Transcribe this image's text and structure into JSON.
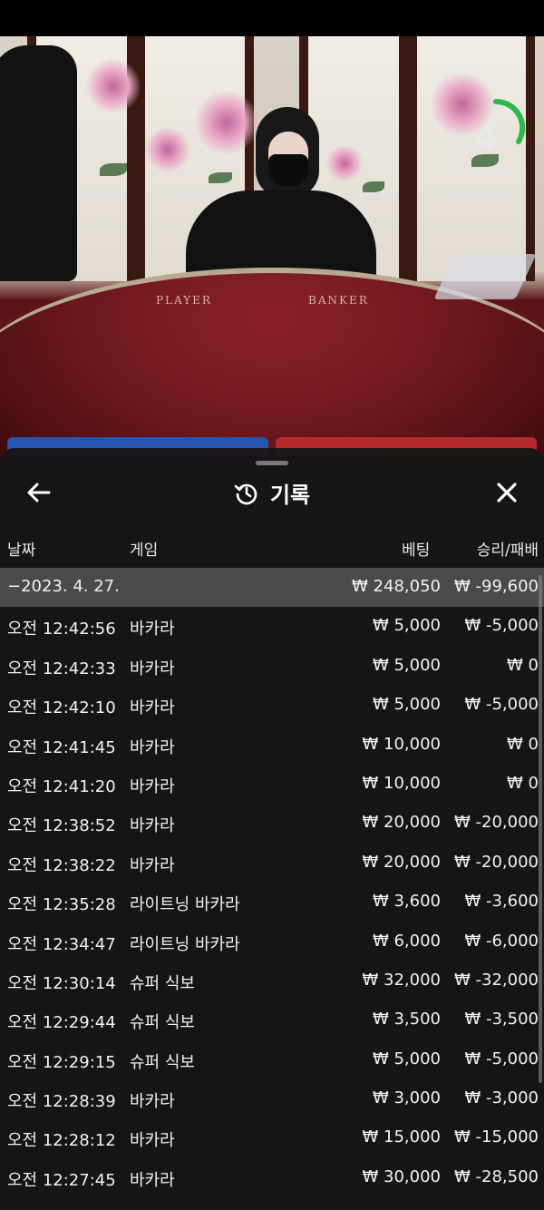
{
  "video": {
    "table_left_label": "PLAYER",
    "table_right_label": "BANKER",
    "timer_value": "4"
  },
  "history": {
    "title": "기록",
    "columns": {
      "date": "날짜",
      "game": "게임",
      "bet": "베팅",
      "result": "승리/패배"
    },
    "date_group": {
      "date": "−2023. 4. 27.",
      "bet": "₩ 248,050",
      "result": "₩ -99,600"
    },
    "rows": [
      {
        "time": "오전 12:42:56",
        "game": "바카라",
        "bet": "₩ 5,000",
        "result": "₩ -5,000"
      },
      {
        "time": "오전 12:42:33",
        "game": "바카라",
        "bet": "₩ 5,000",
        "result": "₩ 0"
      },
      {
        "time": "오전 12:42:10",
        "game": "바카라",
        "bet": "₩ 5,000",
        "result": "₩ -5,000"
      },
      {
        "time": "오전 12:41:45",
        "game": "바카라",
        "bet": "₩ 10,000",
        "result": "₩ 0"
      },
      {
        "time": "오전 12:41:20",
        "game": "바카라",
        "bet": "₩ 10,000",
        "result": "₩ 0"
      },
      {
        "time": "오전 12:38:52",
        "game": "바카라",
        "bet": "₩ 20,000",
        "result": "₩ -20,000"
      },
      {
        "time": "오전 12:38:22",
        "game": "바카라",
        "bet": "₩ 20,000",
        "result": "₩ -20,000"
      },
      {
        "time": "오전 12:35:28",
        "game": "라이트닝 바카라",
        "bet": "₩ 3,600",
        "result": "₩ -3,600"
      },
      {
        "time": "오전 12:34:47",
        "game": "라이트닝 바카라",
        "bet": "₩ 6,000",
        "result": "₩ -6,000"
      },
      {
        "time": "오전 12:30:14",
        "game": "슈퍼 식보",
        "bet": "₩ 32,000",
        "result": "₩ -32,000"
      },
      {
        "time": "오전 12:29:44",
        "game": "슈퍼 식보",
        "bet": "₩ 3,500",
        "result": "₩ -3,500"
      },
      {
        "time": "오전 12:29:15",
        "game": "슈퍼 식보",
        "bet": "₩ 5,000",
        "result": "₩ -5,000"
      },
      {
        "time": "오전 12:28:39",
        "game": "바카라",
        "bet": "₩ 3,000",
        "result": "₩ -3,000"
      },
      {
        "time": "오전 12:28:12",
        "game": "바카라",
        "bet": "₩ 15,000",
        "result": "₩ -15,000"
      },
      {
        "time": "오전 12:27:45",
        "game": "바카라",
        "bet": "₩ 30,000",
        "result": "₩ -28,500"
      }
    ]
  },
  "colors": {
    "panel_bg": "#161616",
    "date_row_bg": "#4a4a4a",
    "timer_arc": "#2fb84a",
    "player_blue": "#2455b3",
    "banker_red": "#b52a2a"
  }
}
